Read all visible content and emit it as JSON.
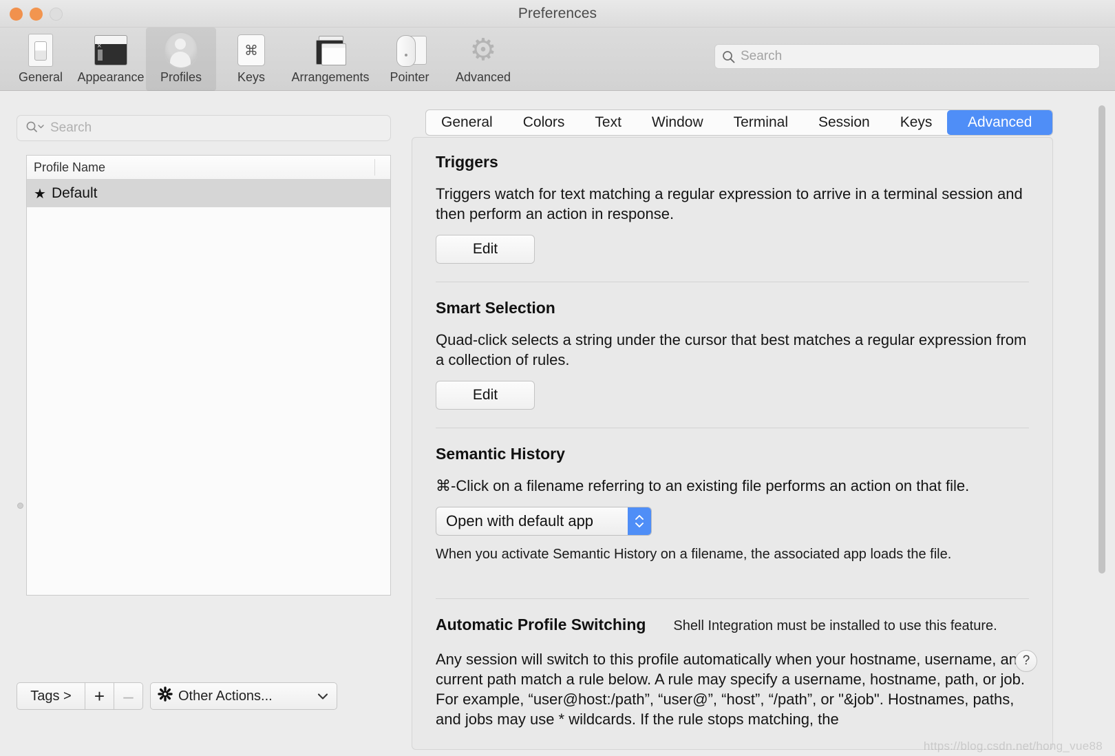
{
  "window": {
    "title": "Preferences",
    "traffic_lights": [
      "close-button",
      "minimize-button",
      "zoom-button"
    ]
  },
  "toolbar": {
    "items": [
      {
        "label": "General",
        "icon": "general-icon",
        "selected": false
      },
      {
        "label": "Appearance",
        "icon": "appearance-icon",
        "selected": false
      },
      {
        "label": "Profiles",
        "icon": "profiles-icon",
        "selected": true
      },
      {
        "label": "Keys",
        "icon": "keys-icon",
        "selected": false
      },
      {
        "label": "Arrangements",
        "icon": "arrangements-icon",
        "selected": false
      },
      {
        "label": "Pointer",
        "icon": "pointer-icon",
        "selected": false
      },
      {
        "label": "Advanced",
        "icon": "advanced-gear-icon",
        "selected": false
      }
    ],
    "search": {
      "placeholder": "Search",
      "value": "",
      "icon": "search-icon"
    }
  },
  "sidebar": {
    "search": {
      "placeholder": "Search",
      "value": "",
      "icon": "search-menu-icon"
    },
    "table": {
      "columns": [
        "Profile Name"
      ],
      "rows": [
        {
          "name": "Default",
          "badge": "★",
          "selected": true
        }
      ]
    },
    "bottom_bar": {
      "tags_label": "Tags >",
      "add_label": "+",
      "remove_label": "–",
      "other_actions_label": "Other Actions...",
      "gear_icon": "gear-icon",
      "chevron_icon": "chevron-down-icon"
    }
  },
  "main": {
    "tabs": [
      {
        "label": "General",
        "active": false
      },
      {
        "label": "Colors",
        "active": false
      },
      {
        "label": "Text",
        "active": false
      },
      {
        "label": "Window",
        "active": false
      },
      {
        "label": "Terminal",
        "active": false
      },
      {
        "label": "Session",
        "active": false
      },
      {
        "label": "Keys",
        "active": false
      },
      {
        "label": "Advanced",
        "active": true
      }
    ],
    "sections": {
      "triggers": {
        "title": "Triggers",
        "body": "Triggers watch for text matching a regular expression to arrive in a terminal session and then perform an action in response.",
        "button": "Edit"
      },
      "smart_selection": {
        "title": "Smart Selection",
        "body": "Quad-click selects a string under the cursor that best matches a regular expression from a collection of rules.",
        "button": "Edit"
      },
      "semantic_history": {
        "title": "Semantic History",
        "body": "⌘-Click on a filename referring to an existing file performs an action on that file.",
        "select_value": "Open with default app",
        "note": "When you activate Semantic History on a filename, the associated app loads the file."
      },
      "automatic_profile_switching": {
        "title": "Automatic Profile Switching",
        "subtitle": "Shell Integration must be installed to use this feature.",
        "help_label": "?",
        "body": "Any session will switch to this profile automatically when your hostname, username, and current path match a rule below. A rule may specify a username, hostname, path, or job. For example, “user@host:/path”, “user@”, “host”, “/path”, or \"&job\". Hostnames, paths, and jobs may use * wildcards. If the rule stops matching, the"
      }
    },
    "scrollbar": {
      "name": "vertical-scrollbar"
    }
  },
  "colors": {
    "accent_blue": "#4f8ef7",
    "window_chrome": "#dcdcdc",
    "panel_bg": "#e9e9e9",
    "selected_row": "#d6d6d6"
  },
  "watermark": "https://blog.csdn.net/hong_vue88"
}
